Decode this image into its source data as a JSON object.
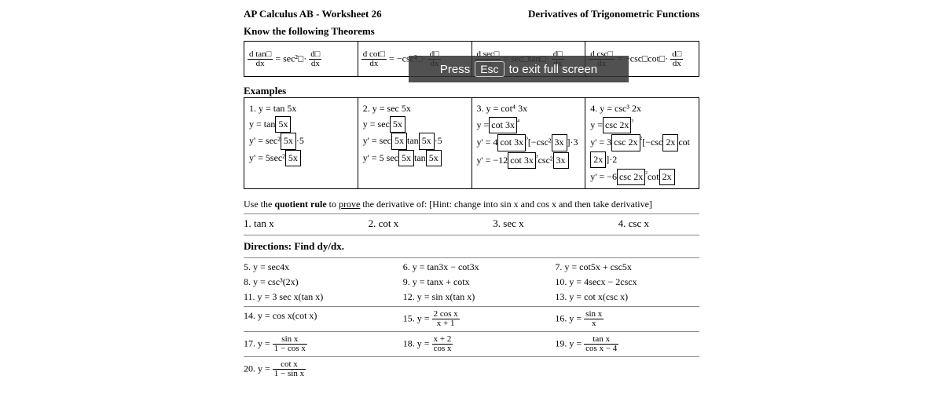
{
  "header": {
    "title": "AP Calculus AB - Worksheet 26",
    "topic": "Derivatives of Trigonometric Functions",
    "sub": "Know the following Theorems"
  },
  "overlay": {
    "pre": "Press",
    "key": "Esc",
    "post": "to exit full screen"
  },
  "identities": {
    "c1_lhs_num": "d tan□",
    "c1_lhs_den": "dx",
    "c1_rhs": "= sec²□·",
    "c1_rhs_num": "d□",
    "c1_rhs_den": "dx",
    "c2_lhs_num": "d cot□",
    "c2_lhs_den": "dx",
    "c2_rhs": "= −csc²□·",
    "c2_rhs_num": "d□",
    "c2_rhs_den": "dx",
    "c3_lhs_num": "d sec□",
    "c3_lhs_den": "dx",
    "c3_rhs": "= sec□tan□·",
    "c3_rhs_num": "d□",
    "c3_rhs_den": "dx",
    "c4_lhs_num": "d csc□",
    "c4_lhs_den": "dx",
    "c4_rhs": "= −csc□cot□·",
    "c4_rhs_num": "d□",
    "c4_rhs_den": "dx"
  },
  "examples_label": "Examples",
  "examples": {
    "ex1": {
      "title": "1. y = tan 5x",
      "l1": "y = tan",
      "b1": "5x",
      "l2": "y' = sec²",
      "b2": "5x",
      "l2b": "·5",
      "l3": "y' = 5sec²",
      "b3": "5x"
    },
    "ex2": {
      "title": "2. y = sec 5x",
      "l1": "y = sec",
      "b1": "5x",
      "l2": "y' = sec",
      "b2a": "5x",
      "l2m": "tan",
      "b2b": "5x",
      "l2t": "·5",
      "l3": "y' = 5 sec",
      "b3a": "5x",
      "l3m": "tan",
      "b3b": "5x"
    },
    "ex3": {
      "title": "3. y = cot⁴ 3x",
      "l1": "y =",
      "b1": "cot 3x",
      "p1": "⁴",
      "l2": "y' = 4",
      "b2a": "cot 3x",
      "p2": "³",
      "mid2": "[−csc²",
      "b2b": "3x",
      "t2": "]·3",
      "l3": "y' = −12",
      "b3a": "cot 3x",
      "p3": "³",
      "mid3": "csc²",
      "b3b": "3x"
    },
    "ex4": {
      "title": "4. y = csc³ 2x",
      "l1": "y =",
      "b1": "csc 2x",
      "p1": "³",
      "l2": "y' = 3",
      "b2a": "csc 2x",
      "p2": "²",
      "mid2": "[−csc",
      "b2b": "2x",
      "m2b": "cot",
      "b2c": "2x",
      "t2": "]·2",
      "l3": "y' = −6",
      "b3a": "csc 2x",
      "p3": "²",
      "mid3": "cot",
      "b3b": "2x"
    }
  },
  "quotient": {
    "instr_a": "Use the ",
    "instr_b": "quotient rule",
    "instr_c": " to ",
    "instr_d": "prove",
    "instr_e": " the derivative of: [Hint: change into sin x and cos x and then take derivative]",
    "p1": "1.  tan x",
    "p2": "2.  cot x",
    "p3": "3.  sec x",
    "p4": "4.  csc x"
  },
  "directions": "Directions:  Find dy/dx.",
  "problems": {
    "p5": "5. y = sec4x",
    "p6": "6.  y = tan3x − cot3x",
    "p7": "7.  y = cot5x + csc5x",
    "p8": "8. y = csc³(2x)",
    "p9": "9.  y = tanx + cotx",
    "p10": "10.  y = 4secx − 2cscx",
    "p11": "11.  y = 3 sec x(tan x)",
    "p12": "12. y = sin x(tan x)",
    "p13": "13. y = cot x(csc x)",
    "p14": "14.  y = cos x(cot x)",
    "p15a": "15.  y =",
    "p15num": "2 cos x",
    "p15den": "x + 1",
    "p16a": "16.  y =",
    "p16num": "sin x",
    "p16den": "x",
    "p17a": "17.  y =",
    "p17num": "sin x",
    "p17den": "1 − cos x",
    "p18a": "18.  y =",
    "p18num": "x + 2",
    "p18den": "cos x",
    "p19a": "19.  y =",
    "p19num": "tan x",
    "p19den": "cos x − 4",
    "p20a": "20.  y =",
    "p20num": "cot x",
    "p20den": "1 − sin x"
  }
}
